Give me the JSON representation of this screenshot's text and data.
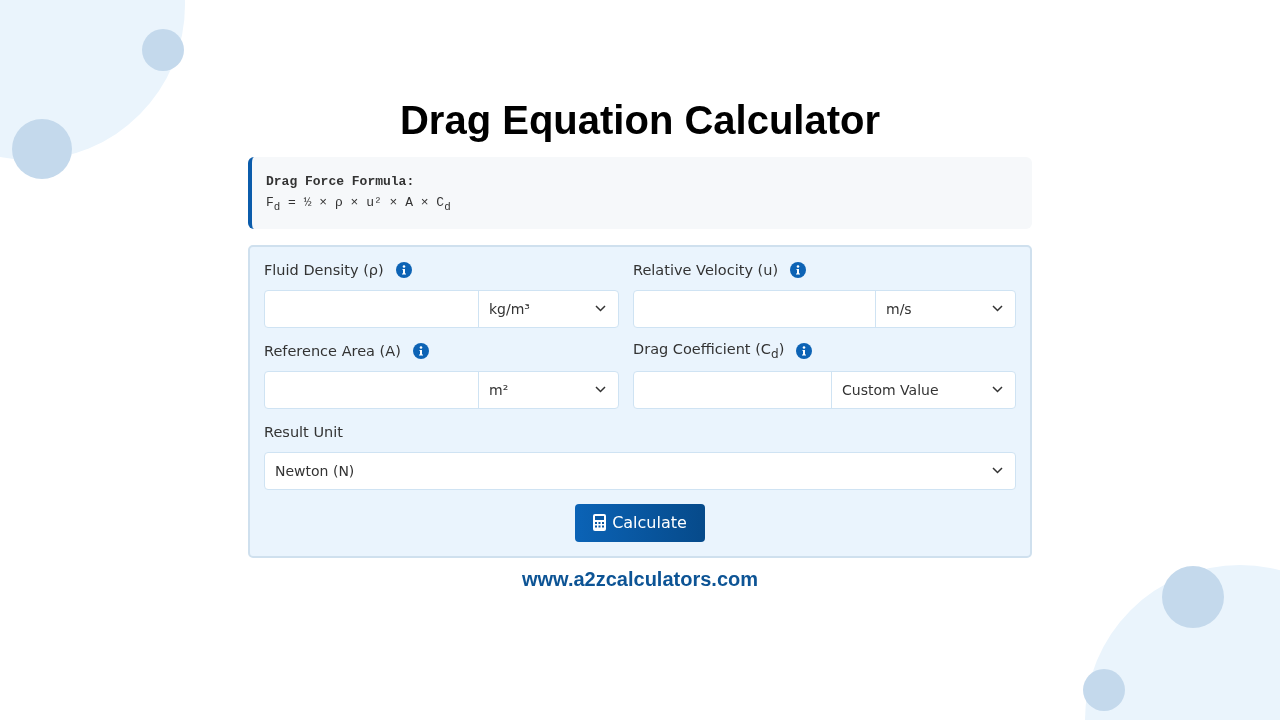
{
  "title": "Drag Equation Calculator",
  "formula": {
    "heading": "Drag Force Formula:",
    "expression": "F$_{d}$ = ½ × ρ × u² × A × C$_{d}$"
  },
  "fields": [
    {
      "kind": "input_select",
      "label": "Fluid Density (ρ)",
      "info": true,
      "unit": "kg/m³"
    },
    {
      "kind": "input_select",
      "label": "Relative Velocity (u)",
      "info": true,
      "unit": "m/s"
    },
    {
      "kind": "input_select",
      "label": "Reference Area (A)",
      "info": true,
      "unit": "m²"
    },
    {
      "kind": "input_select_wide",
      "label": "Drag Coefficient (C$_{d}$)",
      "info": true,
      "unit": "Custom Value"
    },
    {
      "kind": "select",
      "label": "Result Unit",
      "info": false,
      "unit": "Newton (N)"
    }
  ],
  "button": "Calculate",
  "footer": "www.a2zcalculators.com"
}
